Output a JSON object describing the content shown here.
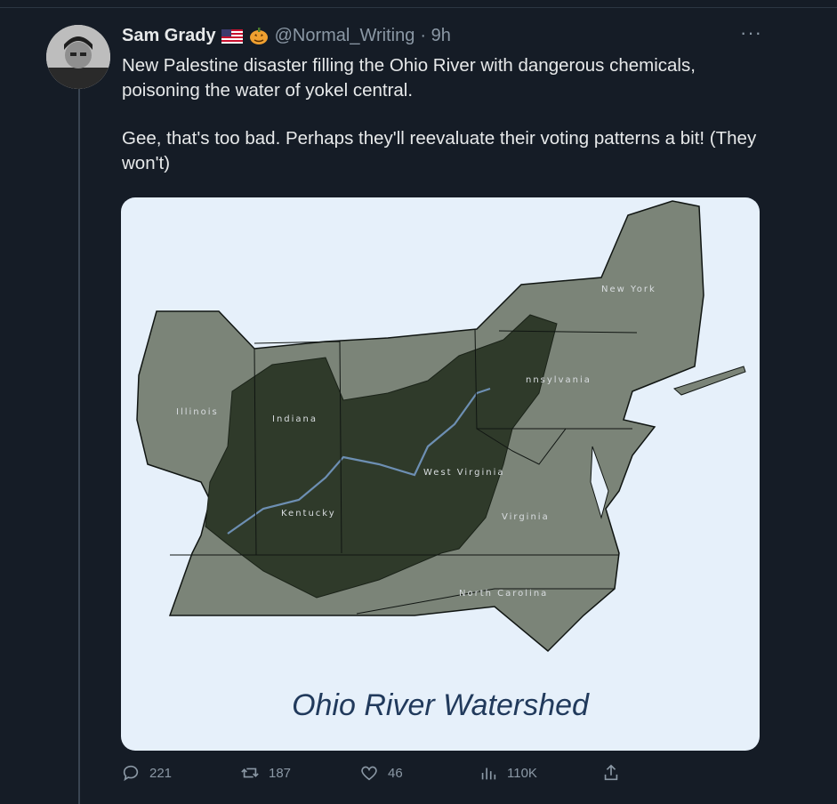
{
  "tweet": {
    "author_name": "Sam Grady",
    "handle": "@Normal_Writing",
    "time": "· 9h",
    "more": "···",
    "text_line1": "New Palestine disaster filling the Ohio River with dangerous chemicals, poisoning the water of yokel central.",
    "text_line2": "Gee, that's too bad. Perhaps they'll reevaluate their voting patterns a bit! (They won't)"
  },
  "media": {
    "caption": "Ohio River Watershed",
    "state_labels": {
      "new_york": "New York",
      "pennsylvania": "nnsylvania",
      "illinois": "Illinois",
      "indiana": "Indiana",
      "west_virginia": "West Virginia",
      "virginia": "Virginia",
      "north_carolina": "North Carolina",
      "kentucky": "Kentucky"
    }
  },
  "actions": {
    "replies": "221",
    "retweets": "187",
    "likes": "46",
    "views": "110K"
  },
  "colors": {
    "background": "#151c26",
    "text": "#e7e9ea",
    "muted": "#8b98a5",
    "watershed": "#2f3a2a",
    "land": "#7b8478"
  },
  "icons": [
    "reply-icon",
    "retweet-icon",
    "like-icon",
    "views-icon",
    "share-icon",
    "us-flag-icon",
    "pumpkin-icon",
    "more-icon"
  ]
}
